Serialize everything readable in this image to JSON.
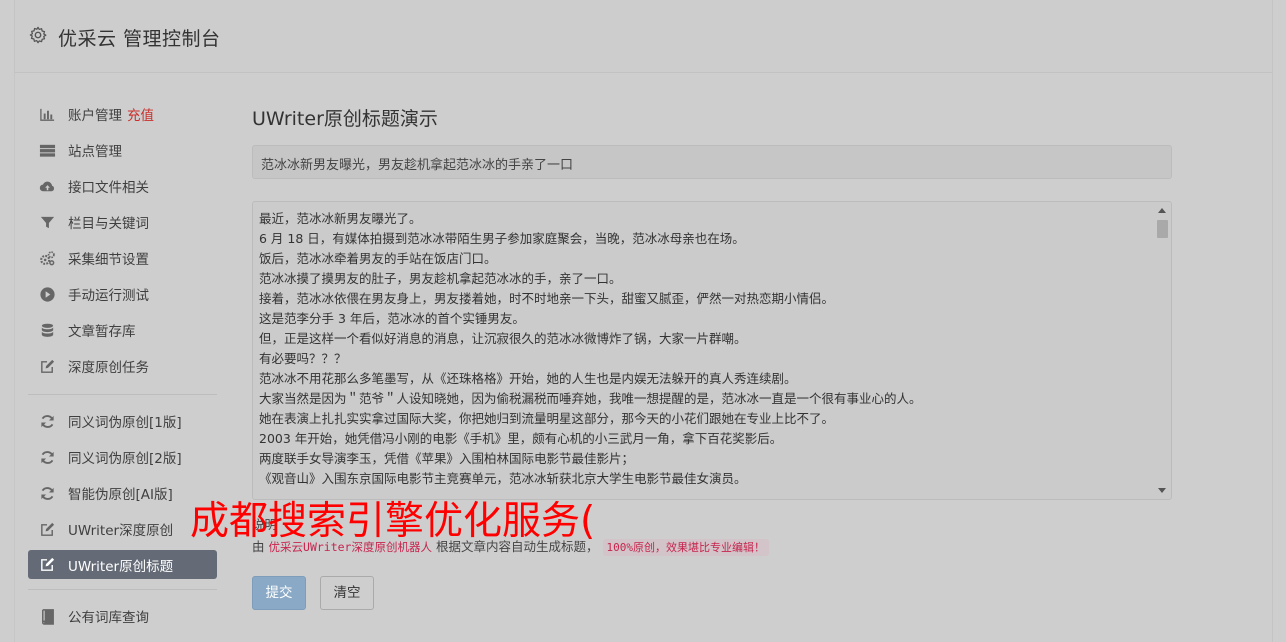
{
  "header": {
    "title": "优采云 管理控制台"
  },
  "sidebar": {
    "group1": [
      {
        "label": "账户管理",
        "badge": "充值",
        "icon": "bar-chart-icon"
      },
      {
        "label": "站点管理",
        "icon": "server-icon"
      },
      {
        "label": "接口文件相关",
        "icon": "cloud-upload-icon"
      },
      {
        "label": "栏目与关键词",
        "icon": "filter-icon"
      },
      {
        "label": "采集细节设置",
        "icon": "cogs-icon"
      },
      {
        "label": "手动运行测试",
        "icon": "play-circle-icon"
      },
      {
        "label": "文章暂存库",
        "icon": "database-icon"
      },
      {
        "label": "深度原创任务",
        "icon": "edit-icon"
      }
    ],
    "group2": [
      {
        "label": "同义词伪原创[1版]",
        "icon": "refresh-icon"
      },
      {
        "label": "同义词伪原创[2版]",
        "icon": "refresh-icon"
      },
      {
        "label": "智能伪原创[AI版]",
        "icon": "refresh-icon"
      },
      {
        "label": "UWriter深度原创",
        "icon": "edit-icon"
      },
      {
        "label": "UWriter原创标题",
        "icon": "edit-icon",
        "active": true
      }
    ],
    "group3": [
      {
        "label": "公有词库查询",
        "icon": "book-icon"
      }
    ]
  },
  "main": {
    "heading": "UWriter原创标题演示",
    "title_value": "范冰冰新男友曝光，男友趁机拿起范冰冰的手亲了一口",
    "content_lines": [
      "最近，范冰冰新男友曝光了。",
      "6 月 18 日，有媒体拍摄到范冰冰带陌生男子参加家庭聚会，当晚，范冰冰母亲也在场。",
      "饭后，范冰冰牵着男友的手站在饭店门口。",
      "范冰冰摸了摸男友的肚子，男友趁机拿起范冰冰的手，亲了一口。",
      "接着，范冰冰依偎在男友身上，男友搂着她，时不时地亲一下头，甜蜜又腻歪，俨然一对热恋期小情侣。",
      "这是范李分手 3 年后，范冰冰的首个实锤男友。",
      "但，正是这样一个看似好消息的消息，让沉寂很久的范冰冰微博炸了锅，大家一片群嘲。",
      "有必要吗？？？",
      "范冰冰不用花那么多笔墨写，从《还珠格格》开始，她的人生也是内娱无法躲开的真人秀连续剧。",
      "大家当然是因为＂范爷＂人设知晓她，因为偷税漏税而唾弃她，我唯一想提醒的是，范冰冰一直是一个很有事业心的人。",
      "她在表演上扎扎实实拿过国际大奖，你把她归到流量明星这部分，那今天的小花们跟她在专业上比不了。",
      "2003 年开始，她凭借冯小刚的电影《手机》里，颇有心机的小三武月一角，拿下百花奖影后。",
      "两度联手女导演李玉，凭借《苹果》入围柏林国际电影节最佳影片；",
      "《观音山》入围东京国际电影节主竞赛单元，范冰冰斩获北京大学生电影节最佳女演员。"
    ],
    "desc_label": "说明",
    "desc_prefix": "由",
    "desc_link": "优采云UWriter深度原创机器人",
    "desc_middle": "根据文章内容自动生成标题，",
    "desc_code": "100%原创，效果堪比专业编辑！",
    "submit_label": "提交",
    "clear_label": "清空"
  },
  "overlay_text": "成都搜索引擎优化服务("
}
